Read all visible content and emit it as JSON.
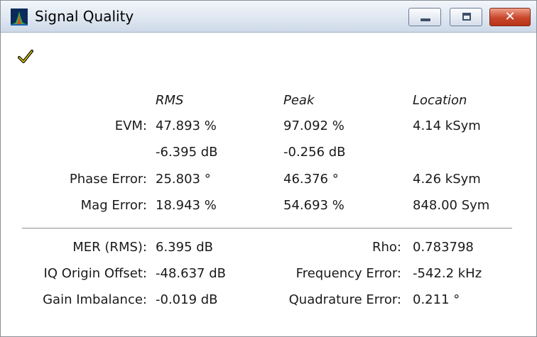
{
  "window": {
    "title": "Signal Quality",
    "close_symbol": "✕",
    "status_icon": "checkmark-icon"
  },
  "columns": {
    "rms": "RMS",
    "peak": "Peak",
    "location": "Location"
  },
  "measurements": {
    "evm": {
      "label": "EVM:",
      "rms": "47.893 %",
      "peak": "97.092 %",
      "location": "4.14 kSym",
      "rms_db": "-6.395 dB",
      "peak_db": "-0.256 dB"
    },
    "phase_error": {
      "label": "Phase Error:",
      "rms": "25.803 °",
      "peak": "46.376 °",
      "location": "4.26 kSym"
    },
    "mag_error": {
      "label": "Mag Error:",
      "rms": "18.943 %",
      "peak": "54.693 %",
      "location": "848.00 Sym"
    }
  },
  "summary": {
    "mer": {
      "label": "MER (RMS):",
      "value": "6.395 dB"
    },
    "rho": {
      "label": "Rho:",
      "value": "0.783798"
    },
    "iq_origin_offset": {
      "label": "IQ Origin Offset:",
      "value": "-48.637 dB"
    },
    "frequency_error": {
      "label": "Frequency Error:",
      "value": "-542.2 kHz"
    },
    "gain_imbalance": {
      "label": "Gain Imbalance:",
      "value": "-0.019 dB"
    },
    "quadrature_error": {
      "label": "Quadrature Error:",
      "value": "0.211 °"
    }
  },
  "colors": {
    "title_gradient_top": "#f3f6fa",
    "close_red": "#c8462b",
    "check_yellow": "#e8d000"
  }
}
